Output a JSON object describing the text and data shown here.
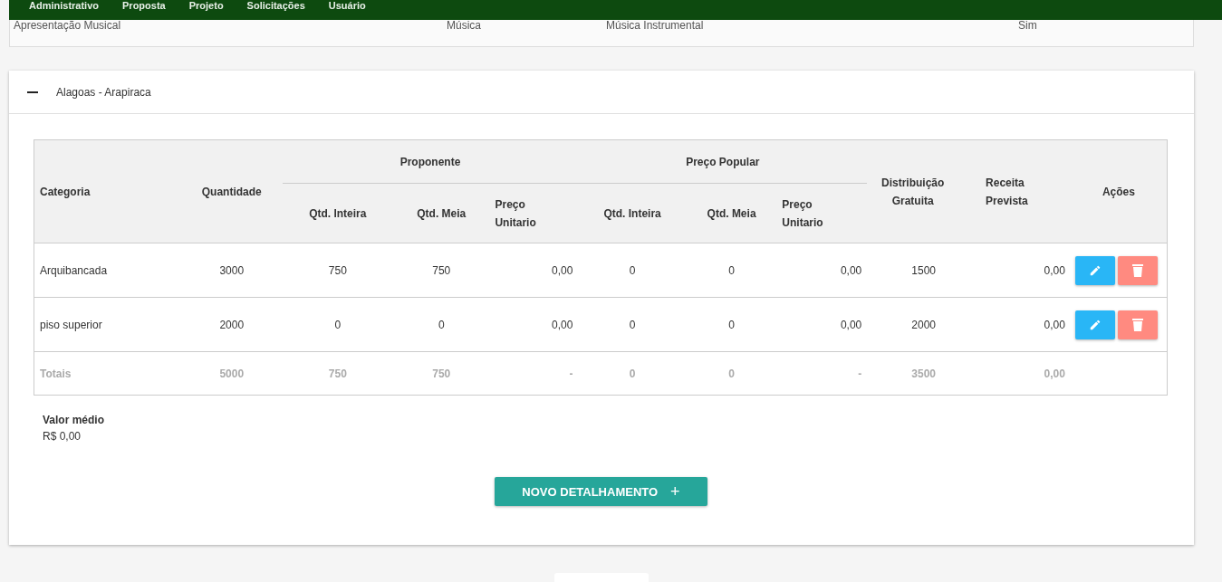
{
  "nav": {
    "items": [
      "Administrativo",
      "Proposta",
      "Projeto",
      "Solicitações",
      "Usuário"
    ]
  },
  "previous_row": {
    "cells": [
      "Apresentação Musical",
      "Música",
      "Música Instrumental",
      "Sim"
    ]
  },
  "panel": {
    "title": "Alagoas - Arapiraca",
    "expanded": true,
    "table": {
      "header": [
        {
          "label": "Categoria",
          "kind": "single"
        },
        {
          "label": "Quantidade",
          "kind": "single"
        },
        {
          "label": "Proponente",
          "kind": "group",
          "columns": [
            "Qtd. Inteira",
            "Qtd. Meia",
            "Preço Unitario"
          ]
        },
        {
          "label": "Preço Popular",
          "kind": "group",
          "columns": [
            "Qtd. Inteira",
            "Qtd. Meia",
            "Preço Unitario"
          ]
        },
        {
          "label": "Distribuição Gratuita",
          "kind": "single"
        },
        {
          "label": "Receita Prevista",
          "kind": "single"
        },
        {
          "label": "Ações",
          "kind": "single"
        }
      ],
      "rows": [
        {
          "kind": "item",
          "cells": [
            "Arquibancada",
            "3000",
            "750",
            "750",
            "0,00",
            "0",
            "0",
            "0,00",
            "1500",
            "0,00"
          ]
        },
        {
          "kind": "item",
          "cells": [
            "piso superior",
            "2000",
            "0",
            "0",
            "0,00",
            "0",
            "0",
            "0,00",
            "2000",
            "0,00"
          ]
        },
        {
          "kind": "total",
          "cells": [
            "Totais",
            "5000",
            "750",
            "750",
            "-",
            "0",
            "0",
            "-",
            "3500",
            "0,00"
          ]
        }
      ]
    },
    "average": {
      "label": "Valor médio",
      "value": "R$ 0,00"
    },
    "add_button": {
      "label": "NOVO DETALHAMENTO",
      "icon": "+"
    }
  }
}
